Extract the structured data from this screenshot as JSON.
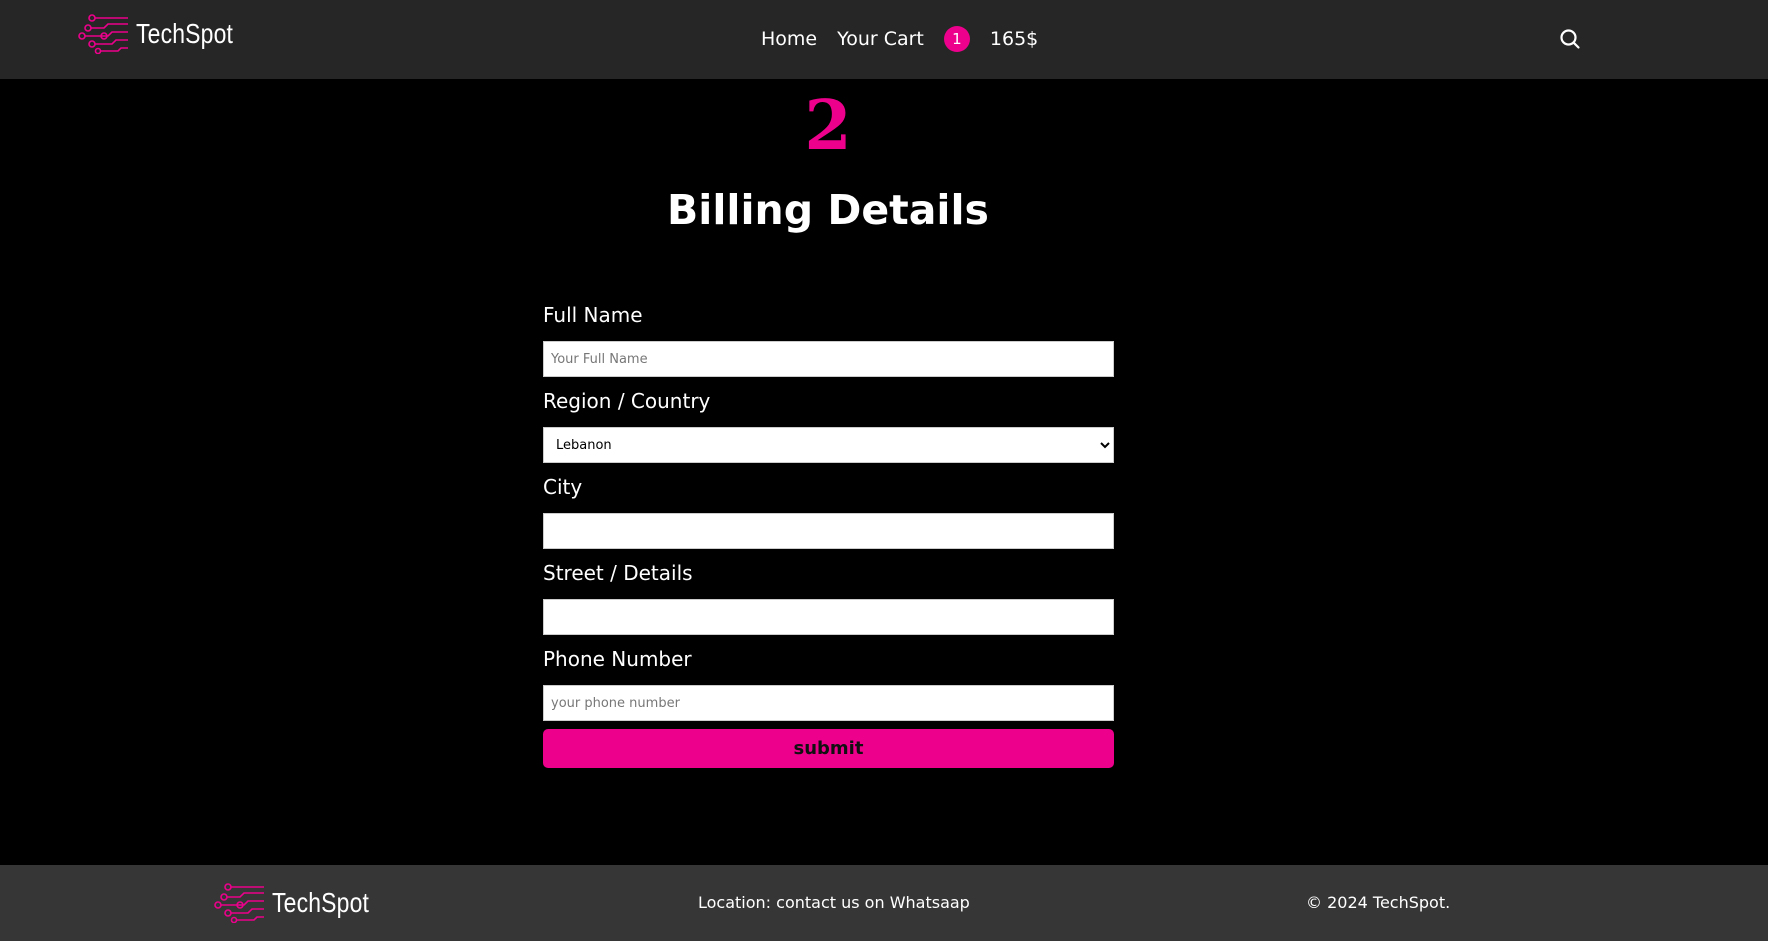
{
  "header": {
    "brand": "TechSpot",
    "nav": {
      "home": "Home",
      "cart": "Your Cart"
    },
    "cart_count": "1",
    "cart_total": "165$",
    "search_icon": "search-icon"
  },
  "main": {
    "step_number": "2",
    "title": "Billing Details",
    "form": {
      "full_name_label": "Full Name",
      "full_name_placeholder": "Your Full Name",
      "region_label": "Region / Country",
      "region_selected": "Lebanon",
      "city_label": "City",
      "street_label": "Street / Details",
      "phone_label": "Phone Number",
      "phone_placeholder": "your phone number",
      "submit_label": "submit"
    }
  },
  "footer": {
    "brand": "TechSpot",
    "location": "Location: contact us on Whatsaap",
    "copyright": "© 2024 TechSpot."
  },
  "colors": {
    "accent": "#ec008c",
    "header_bg": "#262626",
    "footer_bg": "#363636",
    "page_bg": "#000000"
  }
}
